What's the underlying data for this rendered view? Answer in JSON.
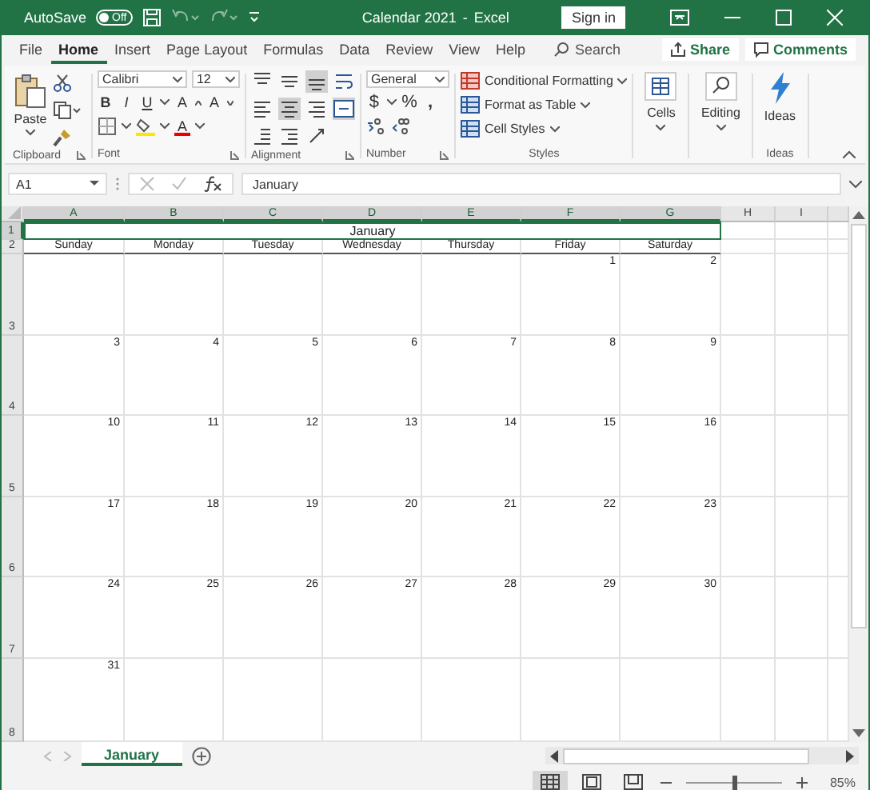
{
  "title_bar": {
    "autosave": "AutoSave",
    "autosave_toggle": {
      "on": false,
      "label": "Off"
    },
    "title": "Calendar 2021",
    "separator": "-",
    "app": "Excel",
    "sign_in": "Sign in"
  },
  "menu_tabs": [
    {
      "label": "File",
      "selected": false
    },
    {
      "label": "Home",
      "selected": true
    },
    {
      "label": "Insert",
      "selected": false
    },
    {
      "label": "Page Layout",
      "selected": false
    },
    {
      "label": "Formulas",
      "selected": false
    },
    {
      "label": "Data",
      "selected": false
    },
    {
      "label": "Review",
      "selected": false
    },
    {
      "label": "View",
      "selected": false
    },
    {
      "label": "Help",
      "selected": false
    }
  ],
  "search": {
    "placeholder": "Search"
  },
  "share": "Share",
  "comments": "Comments",
  "ribbon": {
    "clipboard": {
      "paste": "Paste",
      "label": "Clipboard"
    },
    "font": {
      "family": "Calibri",
      "size": "12",
      "bold": "B",
      "italic": "I",
      "underline": "U",
      "grow": "A",
      "shrink": "A",
      "font_color": "A",
      "label": "Font"
    },
    "alignment": {
      "label": "Alignment",
      "buttons": [
        {
          "kind": "top",
          "selected": false
        },
        {
          "kind": "middle",
          "selected": false
        },
        {
          "kind": "bottom",
          "selected": true
        },
        {
          "kind": "wrap",
          "selected": false
        },
        {
          "kind": "left",
          "selected": false
        },
        {
          "kind": "center",
          "selected": true
        },
        {
          "kind": "right",
          "selected": false
        },
        {
          "kind": "merge",
          "selected": true
        },
        {
          "kind": "outdent",
          "selected": false
        },
        {
          "kind": "indent",
          "selected": false
        },
        {
          "kind": "orientation",
          "selected": false
        }
      ]
    },
    "number": {
      "format": "General",
      "currency": "$",
      "percent": "%",
      "comma": ",",
      "label": "Number"
    },
    "styles": {
      "items": [
        "Conditional Formatting",
        "Format as Table",
        "Cell Styles"
      ],
      "label": "Styles"
    },
    "cells": "Cells",
    "editing": "Editing",
    "ideas": {
      "button": "Ideas",
      "label": "Ideas"
    }
  },
  "formula_bar": {
    "name_box": "A1",
    "value": "January"
  },
  "columns": [
    {
      "letter": "A",
      "selected": true
    },
    {
      "letter": "B",
      "selected": true
    },
    {
      "letter": "C",
      "selected": true
    },
    {
      "letter": "D",
      "selected": true
    },
    {
      "letter": "E",
      "selected": true
    },
    {
      "letter": "F",
      "selected": true
    },
    {
      "letter": "G",
      "selected": true
    },
    {
      "letter": "H",
      "selected": false
    },
    {
      "letter": "I",
      "selected": false
    }
  ],
  "rows": [
    {
      "number": "1",
      "kind": "title",
      "selected": true,
      "text": "January"
    },
    {
      "number": "2",
      "kind": "weekdays",
      "selected": false,
      "cells": [
        "Sunday",
        "Monday",
        "Tuesday",
        "Wednesday",
        "Thursday",
        "Friday",
        "Saturday"
      ]
    },
    {
      "number": "3",
      "kind": "week",
      "selected": false,
      "cells": [
        null,
        null,
        null,
        null,
        null,
        "1",
        "2"
      ]
    },
    {
      "number": "4",
      "kind": "week",
      "selected": false,
      "cells": [
        "3",
        "4",
        "5",
        "6",
        "7",
        "8",
        "9"
      ]
    },
    {
      "number": "5",
      "kind": "week",
      "selected": false,
      "cells": [
        "10",
        "11",
        "12",
        "13",
        "14",
        "15",
        "16"
      ]
    },
    {
      "number": "6",
      "kind": "week",
      "selected": false,
      "cells": [
        "17",
        "18",
        "19",
        "20",
        "21",
        "22",
        "23"
      ]
    },
    {
      "number": "7",
      "kind": "week",
      "selected": false,
      "cells": [
        "24",
        "25",
        "26",
        "27",
        "28",
        "29",
        "30"
      ]
    },
    {
      "number": "8",
      "kind": "week",
      "selected": false,
      "cells": [
        "31",
        null,
        null,
        null,
        null,
        null,
        null
      ]
    }
  ],
  "sheet_tabs": [
    {
      "label": "January",
      "selected": true
    }
  ],
  "status_bar": {
    "views": [
      {
        "kind": "normal",
        "selected": true
      },
      {
        "kind": "page_layout",
        "selected": false
      },
      {
        "kind": "page_break",
        "selected": false
      }
    ],
    "zoom": {
      "level": 0.5,
      "reading": "85%"
    }
  }
}
